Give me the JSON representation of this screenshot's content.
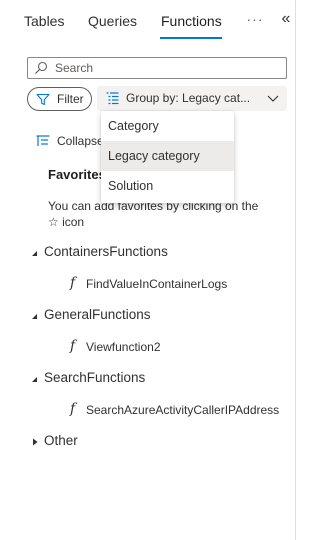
{
  "tabs": [
    {
      "label": "Tables"
    },
    {
      "label": "Queries"
    },
    {
      "label": "Functions",
      "active": true
    }
  ],
  "header": {
    "more_icon": "ellipsis-icon",
    "collapse_icon": "double-chevron-left-icon"
  },
  "search": {
    "placeholder": "Search",
    "value": ""
  },
  "toolbar": {
    "filter_label": "Filter",
    "group_by_label": "Group by: Legacy cat..."
  },
  "dropdown": {
    "options": [
      "Category",
      "Legacy category",
      "Solution"
    ],
    "selected": "Legacy category"
  },
  "collapse_all": {
    "label": "Collapse all"
  },
  "favorites": {
    "title": "Favorites",
    "hint": "You can add favorites by clicking on the ☆ icon"
  },
  "groups": [
    {
      "name": "ContainersFunctions",
      "expanded": true,
      "items": [
        {
          "name": "FindValueInContainerLogs"
        }
      ]
    },
    {
      "name": "GeneralFunctions",
      "expanded": true,
      "items": [
        {
          "name": "Viewfunction2"
        }
      ]
    },
    {
      "name": "SearchFunctions",
      "expanded": true,
      "items": [
        {
          "name": "SearchAzureActivityCallerIPAddress"
        }
      ]
    },
    {
      "name": "Other",
      "expanded": false,
      "items": []
    }
  ],
  "colors": {
    "accent": "#0078d4",
    "text": "#323130",
    "selected_bg": "#edebe9"
  }
}
